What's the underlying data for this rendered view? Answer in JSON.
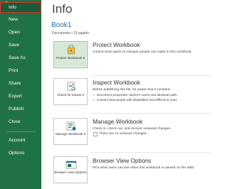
{
  "sidebar": {
    "items": [
      {
        "label": "Info",
        "active": true
      },
      {
        "label": "New"
      },
      {
        "label": "Open"
      },
      {
        "label": "Save"
      },
      {
        "label": "Save As"
      },
      {
        "label": "Print"
      },
      {
        "label": "Share"
      },
      {
        "label": "Export"
      },
      {
        "label": "Publish"
      },
      {
        "label": "Close"
      },
      {
        "label": "Account"
      },
      {
        "label": "Options"
      }
    ]
  },
  "main": {
    "title": "Info",
    "doc_name": "Book1",
    "doc_path": "Documents » Dl pajetto",
    "sections": [
      {
        "tile_label": "Protect Workbook ▾",
        "heading": "Protect Workbook",
        "desc": "Control what types of changes people can make to this workbook."
      },
      {
        "tile_label": "Check for Issues ▾",
        "heading": "Inspect Workbook",
        "desc": "Before publishing this file, be aware that it contains:",
        "bullets": [
          "Document properties, author's name and absolute path",
          "Content that people with disabilities find difficult to read"
        ]
      },
      {
        "tile_label": "Manage Workbook ▾",
        "heading": "Manage Workbook",
        "desc": "Check in, check out, and recover unsaved changes.",
        "note": "There are no unsaved changes."
      },
      {
        "tile_label": "Browser View Options",
        "heading": "Browser View Options",
        "desc": "Pick what users can see when this workbook is viewed on the Web."
      }
    ]
  },
  "colors": {
    "sidebar": "#207245",
    "active_item": "#1a5c37",
    "highlight": "#e03030",
    "doc_name": "#2b6c9e"
  },
  "icons": [
    "back-arrow-icon",
    "lock-icon",
    "inspect-icon",
    "manage-workbook-icon",
    "browser-view-icon",
    "no-changes-icon"
  ]
}
